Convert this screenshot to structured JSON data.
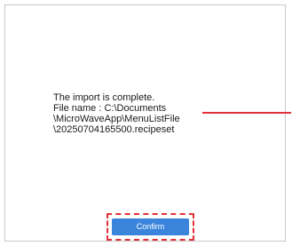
{
  "dialog": {
    "message_lines": [
      "The import is complete.",
      "File name : C:\\Documents",
      "\\MicroWaveApp\\MenuListFile",
      "\\20250704165500.recipeset"
    ],
    "confirm_label": "Confirm"
  },
  "colors": {
    "button_bg": "#3a84dc",
    "annotation": "#e0303a"
  }
}
